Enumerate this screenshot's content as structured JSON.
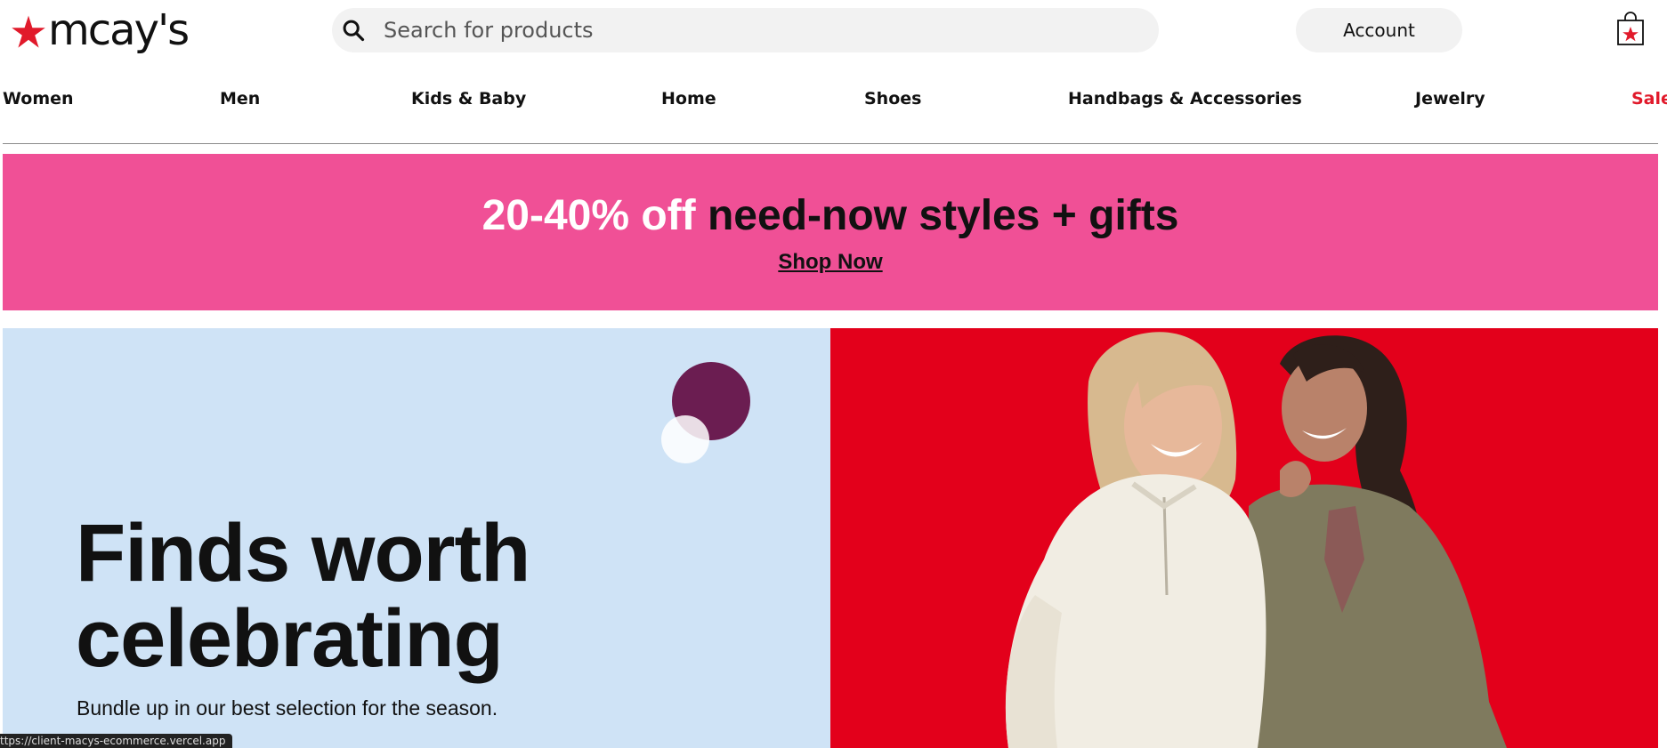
{
  "header": {
    "logo_text": "mcay's",
    "search_placeholder": "Search for products",
    "account_label": "Account"
  },
  "nav": {
    "items": [
      "Women",
      "Men",
      "Kids & Baby",
      "Home",
      "Shoes",
      "Handbags & Accessories",
      "Jewelry",
      "Sale"
    ]
  },
  "promo": {
    "headline_highlight": "20-40% off",
    "headline_rest": "need-now styles + gifts",
    "link_label": "Shop Now"
  },
  "hero": {
    "title": "Finds worth celebrating",
    "subtitle": "Bundle up in our best selection for the season."
  },
  "status_bar": {
    "url": "ttps://client-macys-ecommerce.vercel.app"
  },
  "colors": {
    "brand_red": "#e11a2b",
    "promo_pink": "#f05096",
    "hero_left_bg": "#cfe3f6",
    "hero_right_bg": "#e3001b",
    "accent_purple": "#6b1d51"
  },
  "icons": {
    "logo": "star-icon",
    "search": "search-icon",
    "cart": "shopping-bag-icon"
  }
}
